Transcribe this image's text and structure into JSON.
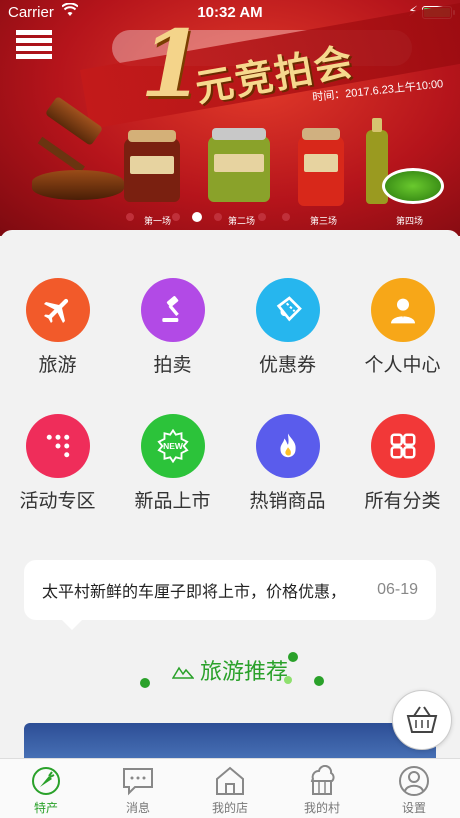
{
  "status_bar": {
    "carrier": "Carrier",
    "time": "10:32 AM"
  },
  "banner": {
    "headline_big": "1",
    "headline": "元竞拍会",
    "event_time": "时间：2017.6.23上午10:00",
    "slides": [
      "第一场",
      "第二场",
      "第三场",
      "第四场"
    ],
    "active_slide": 1
  },
  "grid": [
    {
      "label": "旅游",
      "icon": "airplane-icon",
      "color": "#f25a2a"
    },
    {
      "label": "拍卖",
      "icon": "gavel-icon",
      "color": "#b24ae6"
    },
    {
      "label": "优惠券",
      "icon": "ticket-icon",
      "color": "#26b6ee"
    },
    {
      "label": "个人中心",
      "icon": "person-icon",
      "color": "#f7a718"
    },
    {
      "label": "活动专区",
      "icon": "grid-dots-icon",
      "color": "#ef2d5a"
    },
    {
      "label": "新品上市",
      "icon": "new-badge-icon",
      "color": "#2cc33a"
    },
    {
      "label": "热销商品",
      "icon": "flame-icon",
      "color": "#5a5cec"
    },
    {
      "label": "所有分类",
      "icon": "categories-icon",
      "color": "#f23838"
    }
  ],
  "notice": {
    "text": "太平村新鲜的车厘子即将上市，价格优惠，",
    "date": "06-19"
  },
  "section": {
    "title": "旅游推荐"
  },
  "tabs": [
    {
      "label": "特产",
      "icon": "carrot-icon",
      "active": true
    },
    {
      "label": "消息",
      "icon": "message-icon",
      "active": false
    },
    {
      "label": "我的店",
      "icon": "store-icon",
      "active": false
    },
    {
      "label": "我的村",
      "icon": "village-icon",
      "active": false
    },
    {
      "label": "设置",
      "icon": "settings-user-icon",
      "active": false
    }
  ],
  "colors": {
    "accent_green": "#2aa12a",
    "banner_red": "#b5141b"
  }
}
